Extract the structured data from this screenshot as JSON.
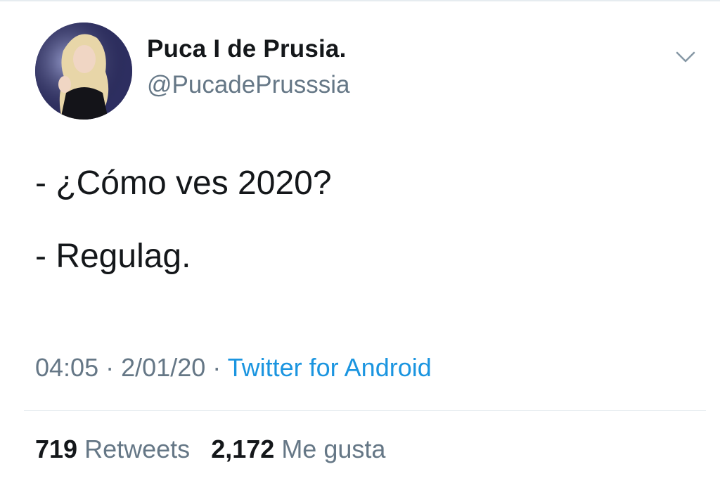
{
  "author": {
    "display_name": "Puca I de Prusia.",
    "handle": "@PucadePrusssia",
    "avatar_icon": "profile-photo"
  },
  "tweet": {
    "lines": [
      "- ¿Cómo ves 2020?",
      "- Regulag."
    ]
  },
  "meta": {
    "time": "04:05",
    "separator": "·",
    "date": "2/01/20",
    "source": "Twitter for Android"
  },
  "stats": {
    "retweets_count": "719",
    "retweets_label": "Retweets",
    "likes_count": "2,172",
    "likes_label": "Me gusta"
  },
  "colors": {
    "text": "#14171a",
    "secondary": "#657786",
    "link": "#1b95e0",
    "divider": "#e1e8ed"
  },
  "icons": {
    "menu": "chevron-down-icon"
  }
}
